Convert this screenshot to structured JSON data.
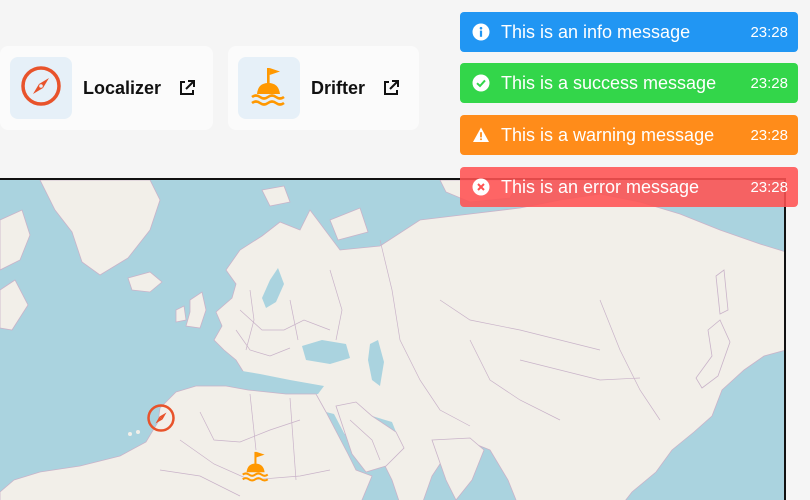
{
  "apps": [
    {
      "name": "Localizer",
      "icon": "compass-icon",
      "color": "#e8532b"
    },
    {
      "name": "Drifter",
      "icon": "buoy-icon",
      "color": "#ff9800"
    }
  ],
  "toasts": [
    {
      "type": "info",
      "message": "This is an info message",
      "time": "23:28",
      "icon": "info-icon",
      "color": "#2196f3"
    },
    {
      "type": "success",
      "message": "This is a success message",
      "time": "23:28",
      "icon": "check-circle-icon",
      "color": "#33d64a"
    },
    {
      "type": "warning",
      "message": "This is a warning message",
      "time": "23:28",
      "icon": "warning-icon",
      "color": "#ff8c1a"
    },
    {
      "type": "error",
      "message": "This is an error message",
      "time": "23:28",
      "icon": "close-circle-icon",
      "color": "#ff5252"
    }
  ],
  "map": {
    "colors": {
      "water": "#aad3df",
      "land": "#f2efe9",
      "border": "#c9b3c9"
    },
    "markers": [
      {
        "type": "localizer",
        "icon": "compass-icon"
      },
      {
        "type": "drifter",
        "icon": "buoy-icon"
      }
    ]
  }
}
